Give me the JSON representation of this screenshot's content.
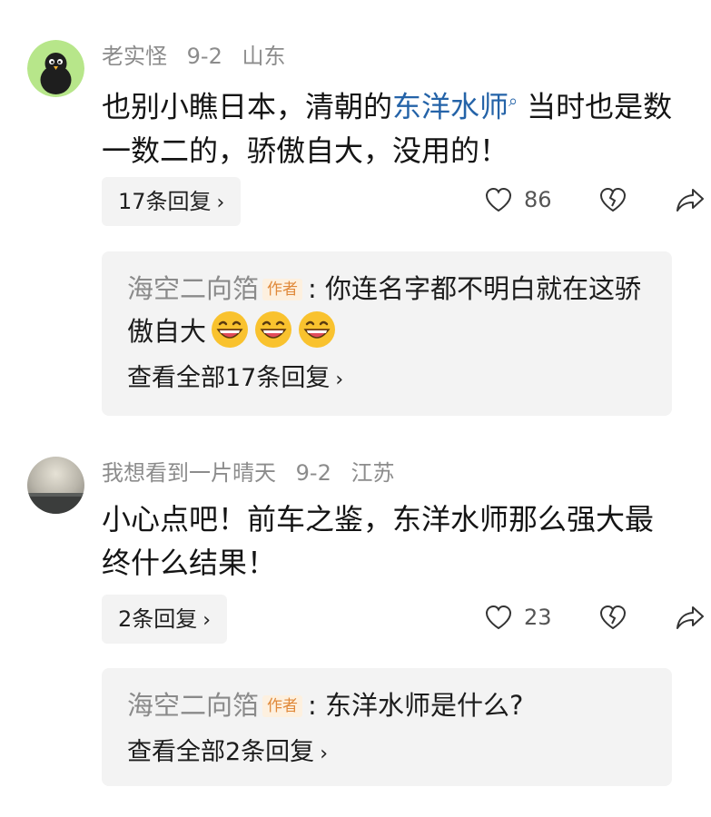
{
  "comments": [
    {
      "username": "老实怪",
      "date": "9-2",
      "location": "山东",
      "text_before": "也别小瞧日本，清朝的",
      "link": "东洋水师",
      "link_icon": "search-mark",
      "text_after": "当时也是数一数二的，骄傲自大，没用的！",
      "reply_count_label": "17条回复",
      "likes": "86",
      "top_reply": {
        "author": "海空二向箔",
        "badge": "作者",
        "text": ": 你连名字都不明白就在这骄傲自大",
        "emojis": [
          "grin-emoji",
          "grin-emoji",
          "grin-emoji"
        ]
      },
      "view_all_label": "查看全部17条回复"
    },
    {
      "username": "我想看到一片晴天",
      "date": "9-2",
      "location": "江苏",
      "text": "小心点吧！前车之鉴，东洋水师那么强大最终什么结果！",
      "reply_count_label": "2条回复",
      "likes": "23",
      "top_reply": {
        "author": "海空二向箔",
        "badge": "作者",
        "text": ": 东洋水师是什么?"
      },
      "view_all_label": "查看全部2条回复"
    }
  ],
  "icons": {
    "like": "heart-outline-icon",
    "dislike": "broken-heart-icon",
    "share": "share-arrow-icon",
    "chevron": "chevron-right-icon"
  }
}
